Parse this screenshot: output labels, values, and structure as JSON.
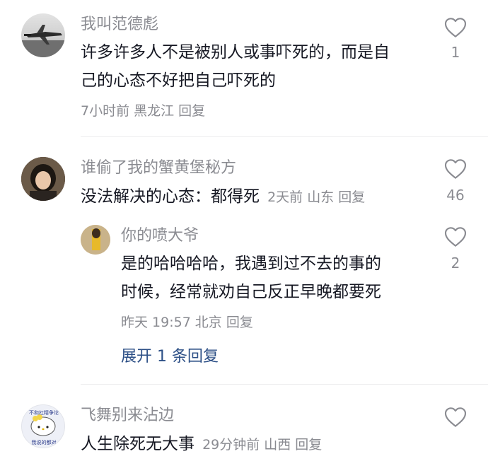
{
  "comments": [
    {
      "username": "我叫范德彪",
      "text_line1": "许多许多人不是被别人或事吓死的，而是自",
      "text_line2": "己的心态不好把自己吓死的",
      "time": "7小时前",
      "location": "黑龙江",
      "reply_label": "回复",
      "like_count": "1"
    },
    {
      "username": "谁偷了我的蟹黄堡秘方",
      "text": "没法解决的心态：都得死",
      "time": "2天前",
      "location": "山东",
      "reply_label": "回复",
      "like_count": "46",
      "reply": {
        "username": "你的喷大爷",
        "text_line1": "是的哈哈哈哈，我遇到过不去的事的",
        "text_line2": "时候，经常就劝自己反正早晚都要死",
        "time": "昨天 19:57",
        "location": "北京",
        "reply_label": "回复",
        "like_count": "2"
      },
      "expand_label": "展开 1 条回复"
    },
    {
      "username": "飞舞别来沾边",
      "text": "人生除死无大事",
      "time": "29分钟前",
      "location": "山西",
      "reply_label": "回复",
      "like_count": "",
      "avatar_text_top": "不和杠精争论",
      "avatar_text_bottom": "我说的都对"
    }
  ],
  "icons": {
    "like": "heart-outline-icon"
  },
  "colors": {
    "text": "#161823",
    "muted": "#8a8b91",
    "link": "#2c4f86",
    "divider": "#ececee"
  }
}
